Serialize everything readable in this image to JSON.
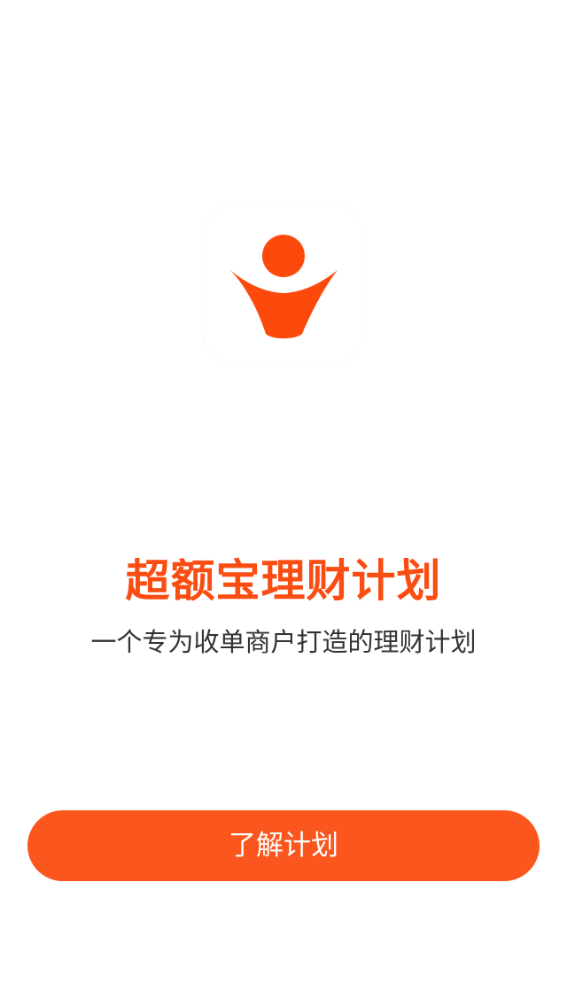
{
  "logo": {
    "icon": "person-raised-arms-logo-icon",
    "color": "#fb4a0c"
  },
  "headline": "超额宝理财计划",
  "tagline": "一个专为收单商户打造的理财计划",
  "cta_button": {
    "label": "了解计划",
    "color": "#fa561d"
  }
}
